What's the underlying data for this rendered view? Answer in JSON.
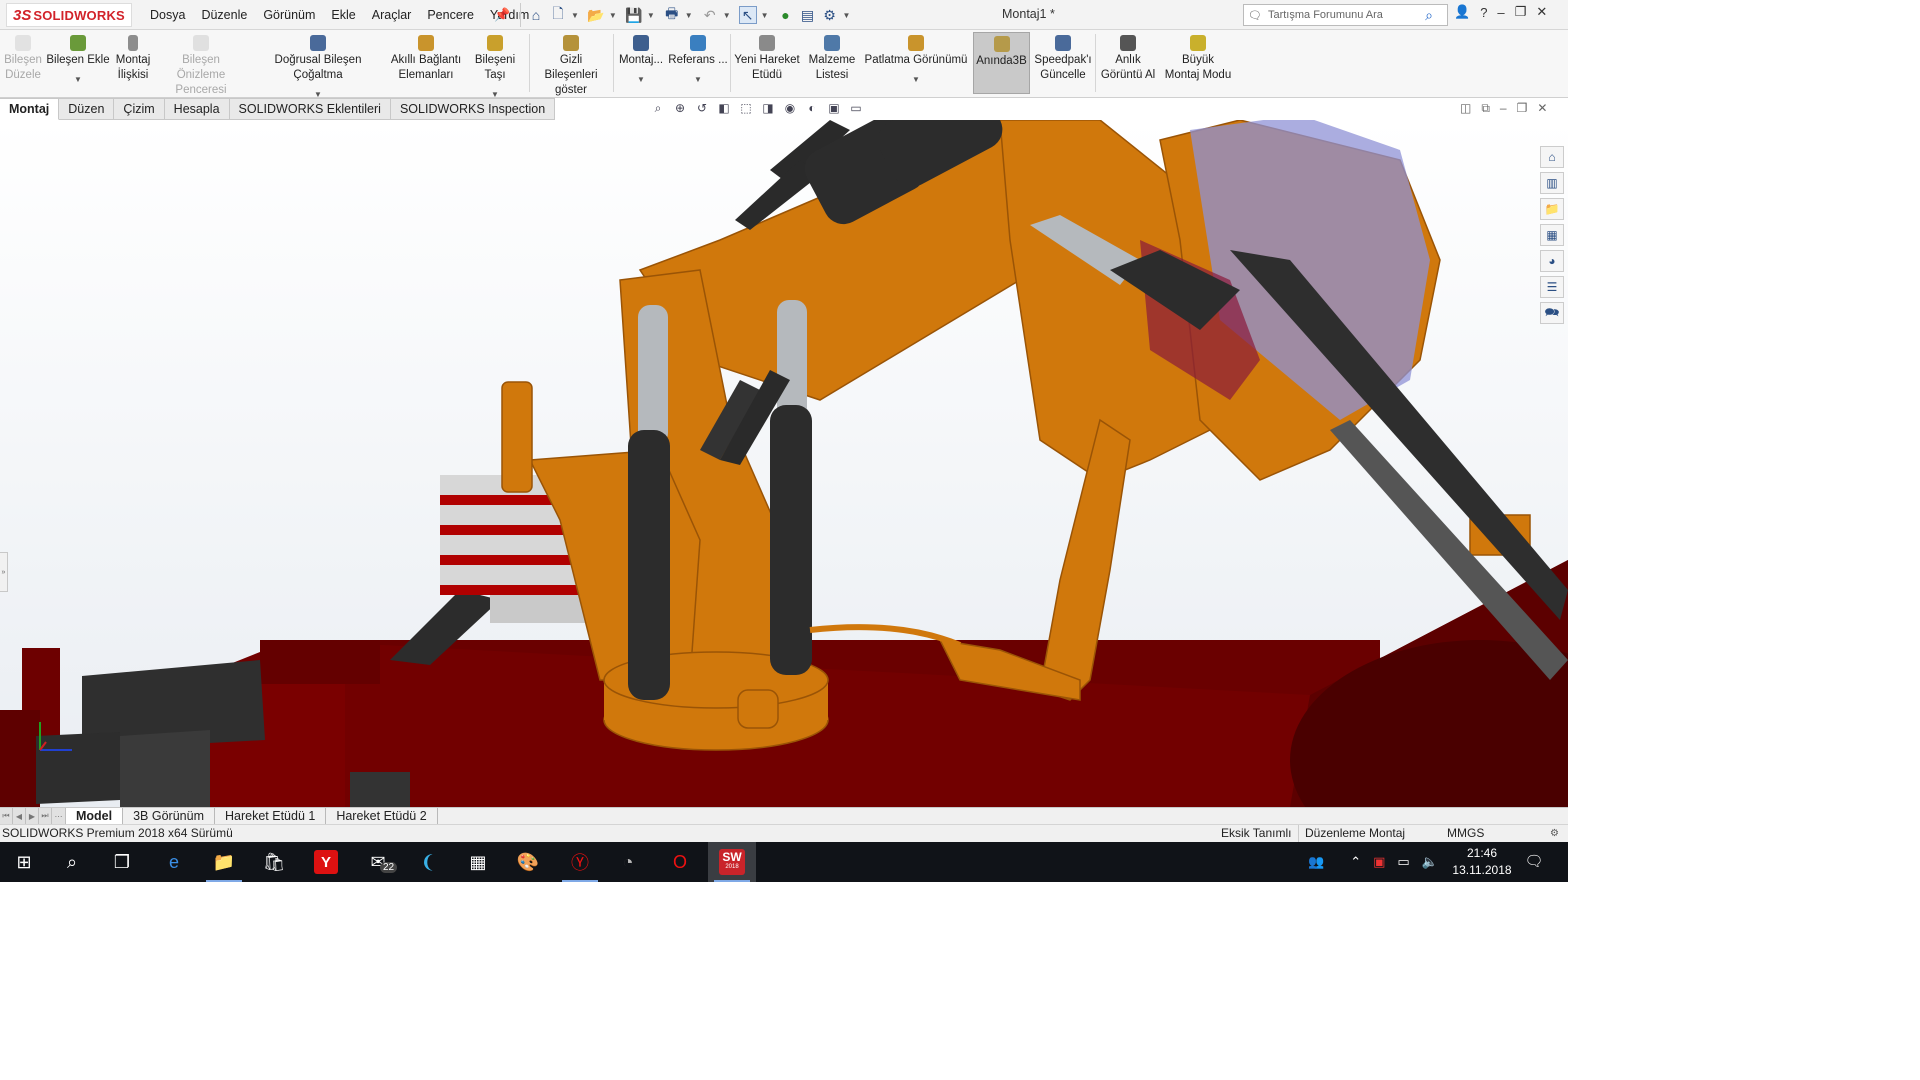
{
  "app": {
    "logo_ds": "3S",
    "logo_name": "SOLIDWORKS",
    "document_title": "Montaj1 *"
  },
  "menu": [
    "Dosya",
    "Düzenle",
    "Görünüm",
    "Ekle",
    "Araçlar",
    "Pencere",
    "Yardım"
  ],
  "search": {
    "placeholder": "Tartışma Forumunu Ara"
  },
  "ribbon": {
    "bilesen_duzenle": [
      "Bileşen",
      "Düzele"
    ],
    "bilesen_ekle": [
      "Bileşen Ekle"
    ],
    "montaj_iliskisi": [
      "Montaj",
      "İlişkisi"
    ],
    "bilesen_onizleme": [
      "Bileşen Önizleme",
      "Penceresi"
    ],
    "dogrusal_cogaltma": [
      "Doğrusal Bileşen Çoğaltma"
    ],
    "akilli_baglanti": [
      "Akıllı Bağlantı",
      "Elemanları"
    ],
    "bileseni_tasi": [
      "Bileşeni Taşı"
    ],
    "gizli_bilesenler": [
      "Gizli Bileşenleri",
      "göster"
    ],
    "montaj_dd": [
      "Montaj..."
    ],
    "referans": [
      "Referans ..."
    ],
    "yeni_hareket": [
      "Yeni Hareket",
      "Etüdü"
    ],
    "malzeme_listesi": [
      "Malzeme",
      "Listesi"
    ],
    "patlatma": [
      "Patlatma Görünümü"
    ],
    "aninda3b": [
      "Anında3B"
    ],
    "speedpak": [
      "Speedpak'ı",
      "Güncelle"
    ],
    "anlik_goruntu": [
      "Anlık",
      "Görüntü Al"
    ],
    "buyuk_montaj": [
      "Büyük",
      "Montaj Modu"
    ]
  },
  "command_tabs": [
    "Montaj",
    "Düzen",
    "Çizim",
    "Hesapla",
    "SOLIDWORKS Eklentileri",
    "SOLIDWORKS Inspection"
  ],
  "bottom_tabs": [
    "Model",
    "3B Görünüm",
    "Hareket Etüdü 1",
    "Hareket Etüdü 2"
  ],
  "status": {
    "version": "SOLIDWORKS Premium 2018 x64 Sürümü",
    "definition": "Eksik Tanımlı",
    "mode": "Düzenleme Montaj",
    "units": "MMGS"
  },
  "taskbar": {
    "mail_badge": "22",
    "sw_label": "SW",
    "sw_year": "2018",
    "time": "21:46",
    "date": "13.11.2018"
  },
  "colors": {
    "brand_red": "#d2232a",
    "machine_orange": "#d0780c",
    "chassis_maroon": "#6b0000",
    "cylinder_dark": "#2c2c2c",
    "piston_gray": "#b5b9bd",
    "cabin_glass": "#8f92d6"
  }
}
